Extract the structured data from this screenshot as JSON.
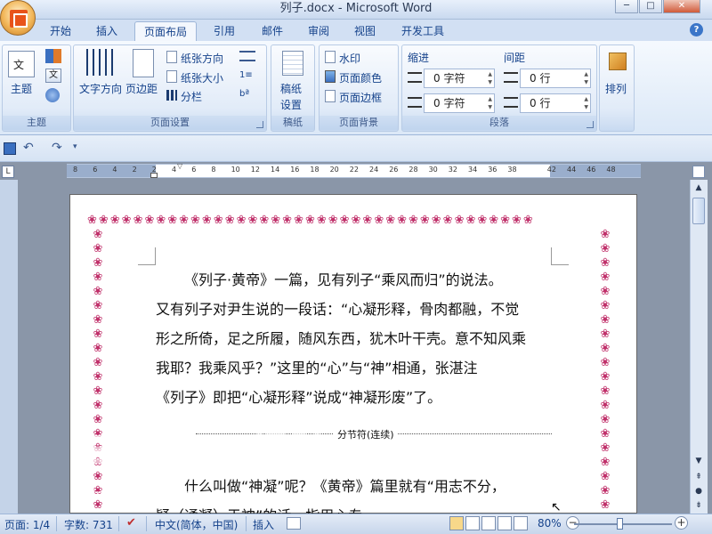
{
  "window": {
    "title": "列子.docx - Microsoft Word",
    "minimize": "─",
    "maximize": "□",
    "close": "✕"
  },
  "tabs": [
    "开始",
    "插入",
    "页面布局",
    "引用",
    "邮件",
    "审阅",
    "视图",
    "开发工具"
  ],
  "active_tab": "页面布局",
  "ribbon": {
    "themes": {
      "group": "主题",
      "theme_label": "主题"
    },
    "page_setup": {
      "group": "页面设置",
      "text_direction": "文字方向",
      "margins": "页边距",
      "orientation": "纸张方向",
      "size": "纸张大小",
      "columns": "分栏"
    },
    "draft": {
      "group": "稿纸",
      "label1": "稿纸",
      "label2": "设置"
    },
    "page_background": {
      "group": "页面背景",
      "watermark": "水印",
      "page_color": "页面颜色",
      "page_borders": "页面边框"
    },
    "paragraph": {
      "group": "段落",
      "indent": "缩进",
      "spacing": "间距",
      "indent_left": "0 字符",
      "indent_right": "0 字符",
      "spacing_before": "0 行",
      "spacing_after": "0 行"
    },
    "arrange": {
      "label": "排列"
    }
  },
  "ruler": {
    "ticks": [
      "8",
      "6",
      "4",
      "2",
      "2",
      "4",
      "6",
      "8",
      "10",
      "12",
      "14",
      "16",
      "18",
      "20",
      "22",
      "24",
      "26",
      "28",
      "30",
      "32",
      "34",
      "36",
      "38",
      "42",
      "44",
      "46",
      "48"
    ]
  },
  "document": {
    "lines": [
      "《列子·黄帝》一篇，见有列子“乘风而归”的说法。",
      "又有列子对尹生说的一段话：“心凝形释，骨肉都融，不觉",
      "形之所倚，足之所履，随风东西，犹木叶干壳。意不知风乘",
      "我耶？我乘风乎？”这里的“心”与“神”相通，张湛注",
      "《列子》即把“心凝形释”说成“神凝形废”了。"
    ],
    "section_break": "分节符(连续)",
    "lines2": [
      "什么叫做“神凝”呢？《黄帝》篇里就有“用志不分，",
      "疑（通凝）于神”的话，指用心专一、……"
    ],
    "watermark": "Bai du 经验",
    "watermark_sub": "jingyan.baidu.com"
  },
  "status": {
    "page": "页面: 1/4",
    "words": "字数: 731",
    "language": "中文(简体，中国)",
    "mode": "插入",
    "zoom": "80%"
  }
}
